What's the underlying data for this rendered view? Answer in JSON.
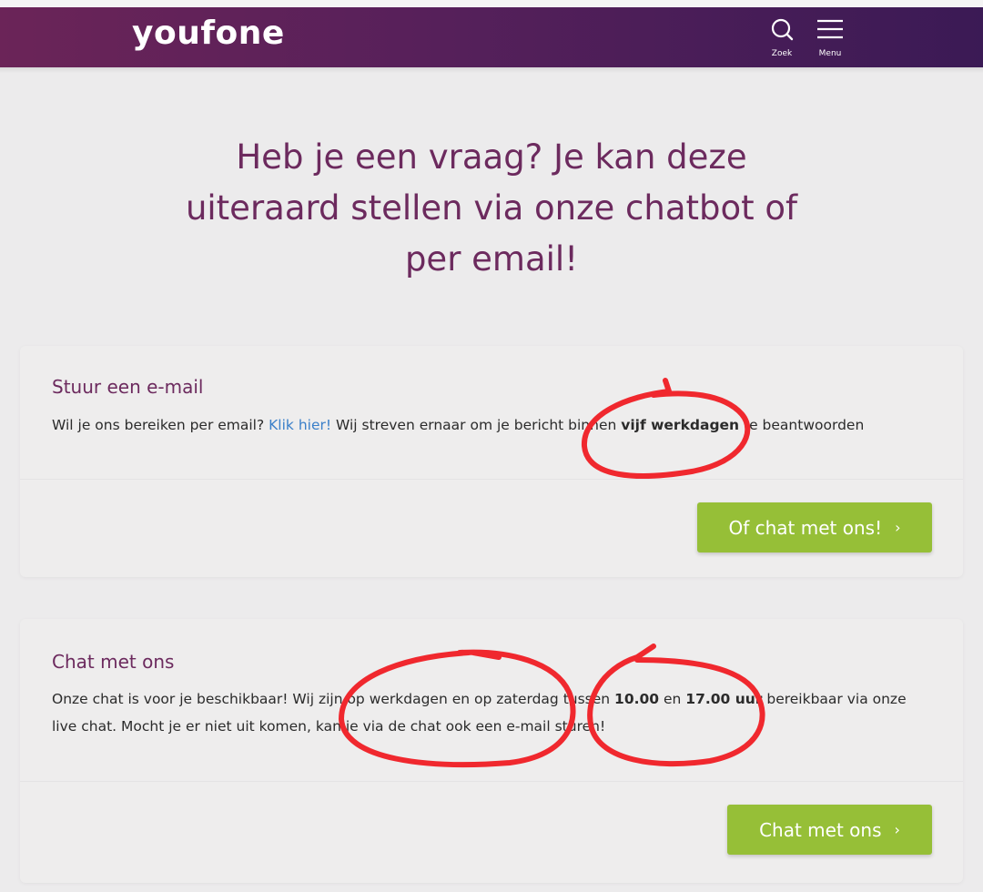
{
  "header": {
    "logo_text": "youfone",
    "search_label": "Zoek",
    "menu_label": "Menu",
    "search_icon": "search-icon",
    "menu_icon": "hamburger-menu-icon"
  },
  "heading": {
    "line1": "Heb je een vraag? Je kan deze",
    "line2": "uiteraard stellen via onze chatbot of",
    "line3": "per email!"
  },
  "email_card": {
    "title": "Stuur een e-mail",
    "text_before": "Wil je ons bereiken per email? ",
    "link": "Klik hier!",
    "text_middle": " Wij streven ernaar om je bericht binnen ",
    "bold": "vijf werkdagen",
    "text_after": " te beantwoorden",
    "button_label": "Of chat met ons!",
    "button_chevron": "›"
  },
  "chat_card": {
    "title": "Chat met ons",
    "text_before": "Onze chat is voor je beschikbaar! Wij zijn op werkdagen en op zaterdag tussen ",
    "bold1": "10.00",
    "text_middle": " en ",
    "bold2": "17.00 uur",
    "text_after": " bereikbaar via onze live chat. Mocht je er niet uit komen, kan je via de chat ook een e-mail sturen!",
    "button_label": "Chat met ons",
    "button_chevron": "›"
  },
  "colors": {
    "brand_purple": "#6c2a5e",
    "header_gradient_start": "#6b2458",
    "header_gradient_end": "#3b1a55",
    "cta_green": "#96bf37",
    "link_blue": "#3a7fc9",
    "annotation_red": "#f0282e"
  }
}
